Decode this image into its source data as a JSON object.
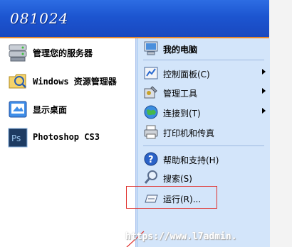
{
  "header": {
    "title": "081024"
  },
  "left_items": [
    {
      "label": "管理您的服务器",
      "icon": "server-icon"
    },
    {
      "label": "Windows 资源管理器",
      "icon": "explorer-folder-icon"
    },
    {
      "label": "显示桌面",
      "icon": "show-desktop-icon"
    },
    {
      "label": "Photoshop CS3",
      "icon": "photoshop-icon",
      "icon_text": "Ps"
    }
  ],
  "right_items": [
    {
      "label": "我的电脑",
      "icon": "my-computer-icon",
      "bold": true
    },
    {
      "label": "控制面板(C)",
      "icon": "control-panel-icon",
      "submenu": true
    },
    {
      "label": "管理工具",
      "icon": "admin-tools-icon",
      "submenu": true
    },
    {
      "label": "连接到(T)",
      "icon": "connect-to-globe-icon",
      "submenu": true
    },
    {
      "label": "打印机和传真",
      "icon": "printer-fax-icon"
    },
    {
      "label": "帮助和支持(H)",
      "icon": "help-support-icon"
    },
    {
      "label": "搜索(S)",
      "icon": "search-icon"
    },
    {
      "label": "运行(R)...",
      "icon": "run-icon"
    }
  ],
  "watermark": "https://www.l7admin.",
  "colors": {
    "header_blue": "#1c55d0",
    "header_accent": "#e88a2e",
    "right_panel": "#d3e5fa",
    "highlight_red": "#e0302c"
  }
}
